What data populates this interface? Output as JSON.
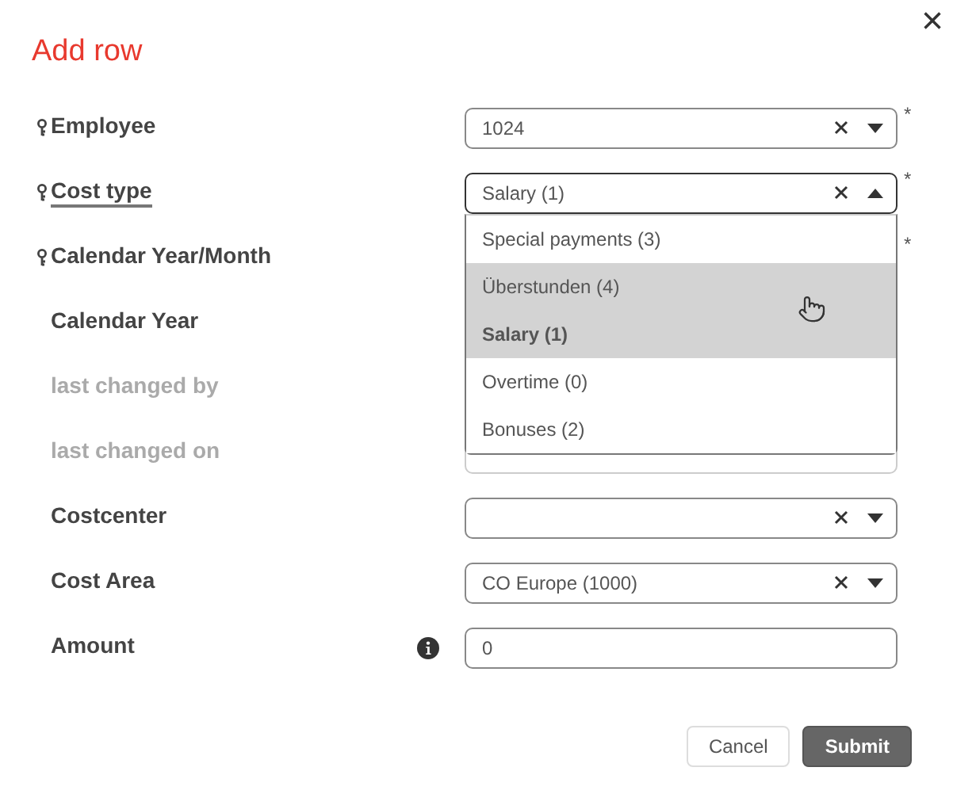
{
  "dialog": {
    "title": "Add row",
    "close": "×"
  },
  "rows": [
    {
      "label": "Employee",
      "key": true,
      "required_mark": "*",
      "focused": false,
      "disabled": false,
      "control": {
        "kind": "select",
        "value": "1024",
        "open": false
      }
    },
    {
      "label": "Cost type",
      "key": true,
      "required_mark": "*",
      "focused": true,
      "disabled": false,
      "control": {
        "kind": "select",
        "value": "Salary (1)",
        "open": true,
        "options": [
          {
            "label": "Special payments (3)",
            "selected": false,
            "hovered": false
          },
          {
            "label": "Überstunden (4)",
            "selected": false,
            "hovered": true
          },
          {
            "label": "Salary (1)",
            "selected": true,
            "hovered": false
          },
          {
            "label": "Overtime (0)",
            "selected": false,
            "hovered": false
          },
          {
            "label": "Bonuses (2)",
            "selected": false,
            "hovered": false
          }
        ]
      }
    },
    {
      "label": "Calendar Year/Month",
      "key": true,
      "required_mark": "*",
      "focused": false,
      "disabled": false
    },
    {
      "label": "Calendar Year",
      "key": false,
      "focused": false,
      "disabled": false
    },
    {
      "label": "last changed by",
      "key": false,
      "focused": false,
      "disabled": true
    },
    {
      "label": "last changed on",
      "key": false,
      "focused": false,
      "disabled": true,
      "control": {
        "kind": "date"
      }
    },
    {
      "label": "Costcenter",
      "key": false,
      "focused": false,
      "disabled": false,
      "control": {
        "kind": "select",
        "open": false
      }
    },
    {
      "label": "Cost Area",
      "key": false,
      "focused": false,
      "disabled": false,
      "control": {
        "kind": "select",
        "value": "CO Europe (1000)",
        "open": false
      }
    },
    {
      "label": "Amount",
      "key": false,
      "focused": false,
      "disabled": false,
      "info": true,
      "control": {
        "kind": "input",
        "value": "0"
      }
    }
  ],
  "buttons": [
    {
      "label": "Cancel",
      "kind": "secondary"
    },
    {
      "label": "Submit",
      "kind": "primary"
    }
  ]
}
